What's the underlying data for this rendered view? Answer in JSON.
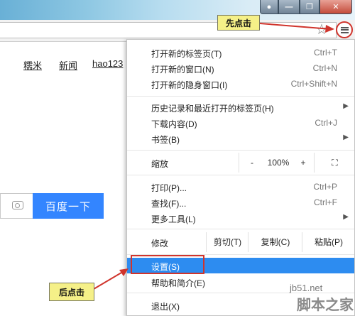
{
  "colors": {
    "accent": "#2d8cf0",
    "baidu_button": "#3385ff",
    "annotation_red": "#d0342c",
    "callout_bg": "#f5f088"
  },
  "window": {
    "user_icon": "user-icon",
    "minimize_icon": "minimize-icon",
    "maximize_icon": "maximize-icon",
    "close_icon": "close-icon"
  },
  "toolbar": {
    "bookmark_icon": "star-icon",
    "menu_icon": "hamburger-menu-icon"
  },
  "page": {
    "nav_links": [
      "糯米",
      "新闻",
      "hao123"
    ],
    "search_button": "百度一下",
    "camera_icon": "camera-icon"
  },
  "menu": {
    "items1": [
      {
        "label": "打开新的标签页(T)",
        "shortcut": "Ctrl+T"
      },
      {
        "label": "打开新的窗口(N)",
        "shortcut": "Ctrl+N"
      },
      {
        "label": "打开新的隐身窗口(I)",
        "shortcut": "Ctrl+Shift+N"
      }
    ],
    "items2": [
      {
        "label": "历史记录和最近打开的标签页(H)",
        "shortcut": ""
      },
      {
        "label": "下载内容(D)",
        "shortcut": "Ctrl+J"
      },
      {
        "label": "书签(B)",
        "shortcut": ""
      }
    ],
    "zoom": {
      "label": "缩放",
      "minus": "-",
      "value": "100%",
      "plus": "+"
    },
    "items3": [
      {
        "label": "打印(P)...",
        "shortcut": "Ctrl+P"
      },
      {
        "label": "查找(F)...",
        "shortcut": "Ctrl+F"
      },
      {
        "label": "更多工具(L)",
        "shortcut": ""
      }
    ],
    "edit": {
      "label": "修改",
      "cut": "剪切(T)",
      "copy": "复制(C)",
      "paste": "粘贴(P)"
    },
    "settings": "设置(S)",
    "help": "帮助和简介(E)",
    "exit": "退出(X)"
  },
  "annotations": {
    "first_click": "先点击",
    "then_click": "后点击"
  },
  "watermark": {
    "line1": "jb51.net",
    "line2": "脚本之家"
  }
}
